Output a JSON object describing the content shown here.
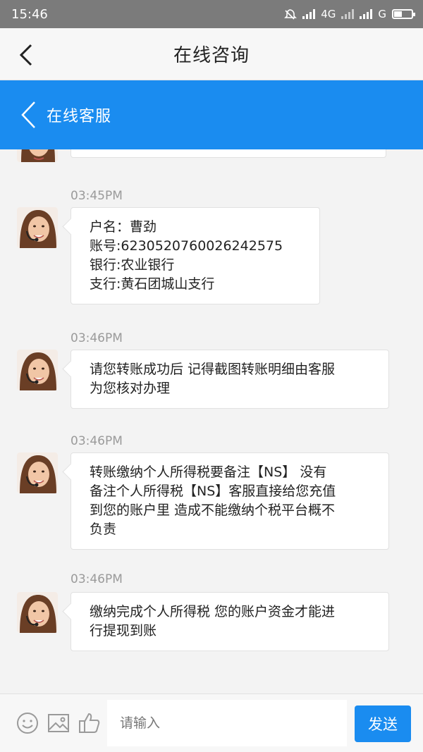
{
  "status_bar": {
    "time": "15:46",
    "network_1": "4G",
    "network_2": "G"
  },
  "header": {
    "title": "在线咨询"
  },
  "subheader": {
    "title": "在线客服"
  },
  "messages": [
    {
      "time": "03:45PM",
      "text": "户名：曹劲\n账号:6230520760026242575\n银行:农业银行\n支行:黄石团城山支行"
    },
    {
      "time": "03:46PM",
      "text": "请您转账成功后 记得截图转账明细由客服\n为您核对办理"
    },
    {
      "time": "03:46PM",
      "text": "转账缴纳个人所得税要备注【NS】 没有\n备注个人所得税【NS】客服直接给您充值\n到您的账户里 造成不能缴纳个税平台概不\n负责"
    },
    {
      "time": "03:46PM",
      "text": "缴纳完成个人所得税 您的账户资金才能进\n行提现到账"
    }
  ],
  "input_bar": {
    "placeholder": "请输入",
    "send_label": "发送",
    "icons": [
      "emoji-icon",
      "image-icon",
      "thumbs-up-icon"
    ]
  },
  "colors": {
    "accent": "#1a8cf0",
    "status_bar": "#7b7b7b",
    "background": "#f3f3f3"
  }
}
